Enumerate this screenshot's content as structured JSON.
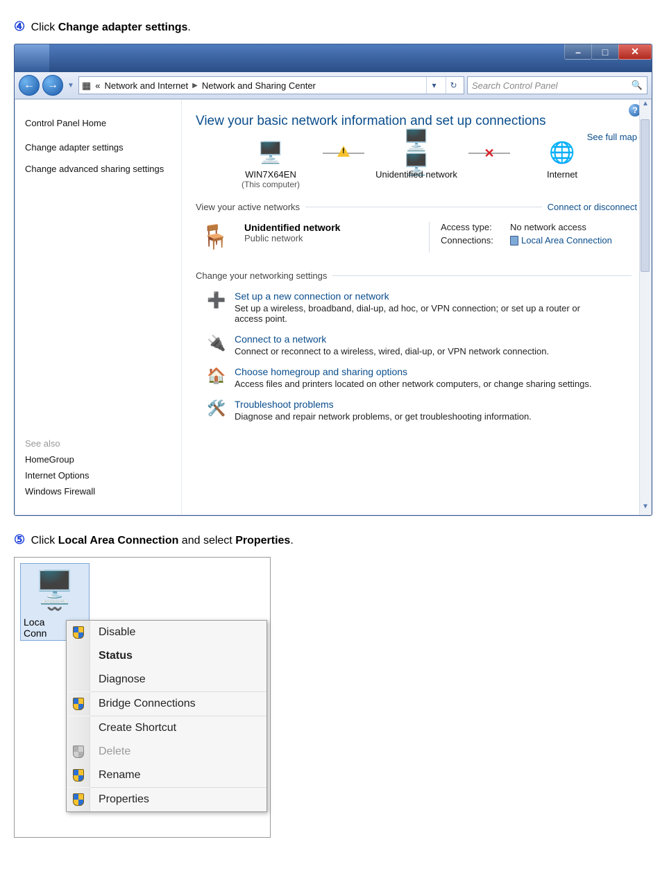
{
  "step4": {
    "num": "④",
    "prefix": "Click ",
    "bold": "Change adapter settings",
    "suffix": "."
  },
  "step5": {
    "num": "⑤",
    "prefix": "Click ",
    "bold1": "Local Area Connection",
    "mid": " and select ",
    "bold2": "Properties",
    "suffix": "."
  },
  "titlebar": {
    "minimize": "–",
    "maximize": "□",
    "close": "✕"
  },
  "nav": {
    "back": "←",
    "forward": "→"
  },
  "breadcrumb": {
    "chev": "«",
    "seg1": "Network and Internet",
    "sep": "▶",
    "seg2": "Network and Sharing Center"
  },
  "search": {
    "placeholder": "Search Control Panel"
  },
  "sidebar": {
    "home": "Control Panel Home",
    "links": [
      "Change adapter settings",
      "Change advanced sharing settings"
    ],
    "see_also_label": "See also",
    "see_also": [
      "HomeGroup",
      "Internet Options",
      "Windows Firewall"
    ]
  },
  "main": {
    "help": "?",
    "title": "View your basic network information and set up connections",
    "see_full_map": "See full map",
    "map": {
      "node1": {
        "name": "WIN7X64EN",
        "sub": "(This computer)"
      },
      "node2": {
        "name": "Unidentified network"
      },
      "node3": {
        "name": "Internet"
      },
      "x": "✕"
    },
    "active_label": "View your active networks",
    "connect_link": "Connect or disconnect",
    "active": {
      "name": "Unidentified network",
      "type": "Public network",
      "access_label": "Access type:",
      "access_value": "No network access",
      "conn_label": "Connections:",
      "conn_value": "Local Area Connection"
    },
    "change_label": "Change your networking settings",
    "items": [
      {
        "link": "Set up a new connection or network",
        "desc": "Set up a wireless, broadband, dial-up, ad hoc, or VPN connection; or set up a router or access point."
      },
      {
        "link": "Connect to a network",
        "desc": "Connect or reconnect to a wireless, wired, dial-up, or VPN network connection."
      },
      {
        "link": "Choose homegroup and sharing options",
        "desc": "Access files and printers located on other network computers, or change sharing settings."
      },
      {
        "link": "Troubleshoot problems",
        "desc": "Diagnose and repair network problems, or get troubleshooting information."
      }
    ]
  },
  "connection_icon": {
    "line1": "Loca",
    "line2": "Conn"
  },
  "context_menu": {
    "items": [
      {
        "label": "Disable",
        "shield": true
      },
      {
        "label": "Status",
        "bold": true
      },
      {
        "label": "Diagnose"
      },
      {
        "sep": true
      },
      {
        "label": "Bridge Connections",
        "shield": true
      },
      {
        "sep": true
      },
      {
        "label": "Create Shortcut"
      },
      {
        "label": "Delete",
        "shield": true,
        "disabled": true,
        "grey_shield": true
      },
      {
        "label": "Rename",
        "shield": true
      },
      {
        "sep": true
      },
      {
        "label": "Properties",
        "shield": true
      }
    ]
  }
}
